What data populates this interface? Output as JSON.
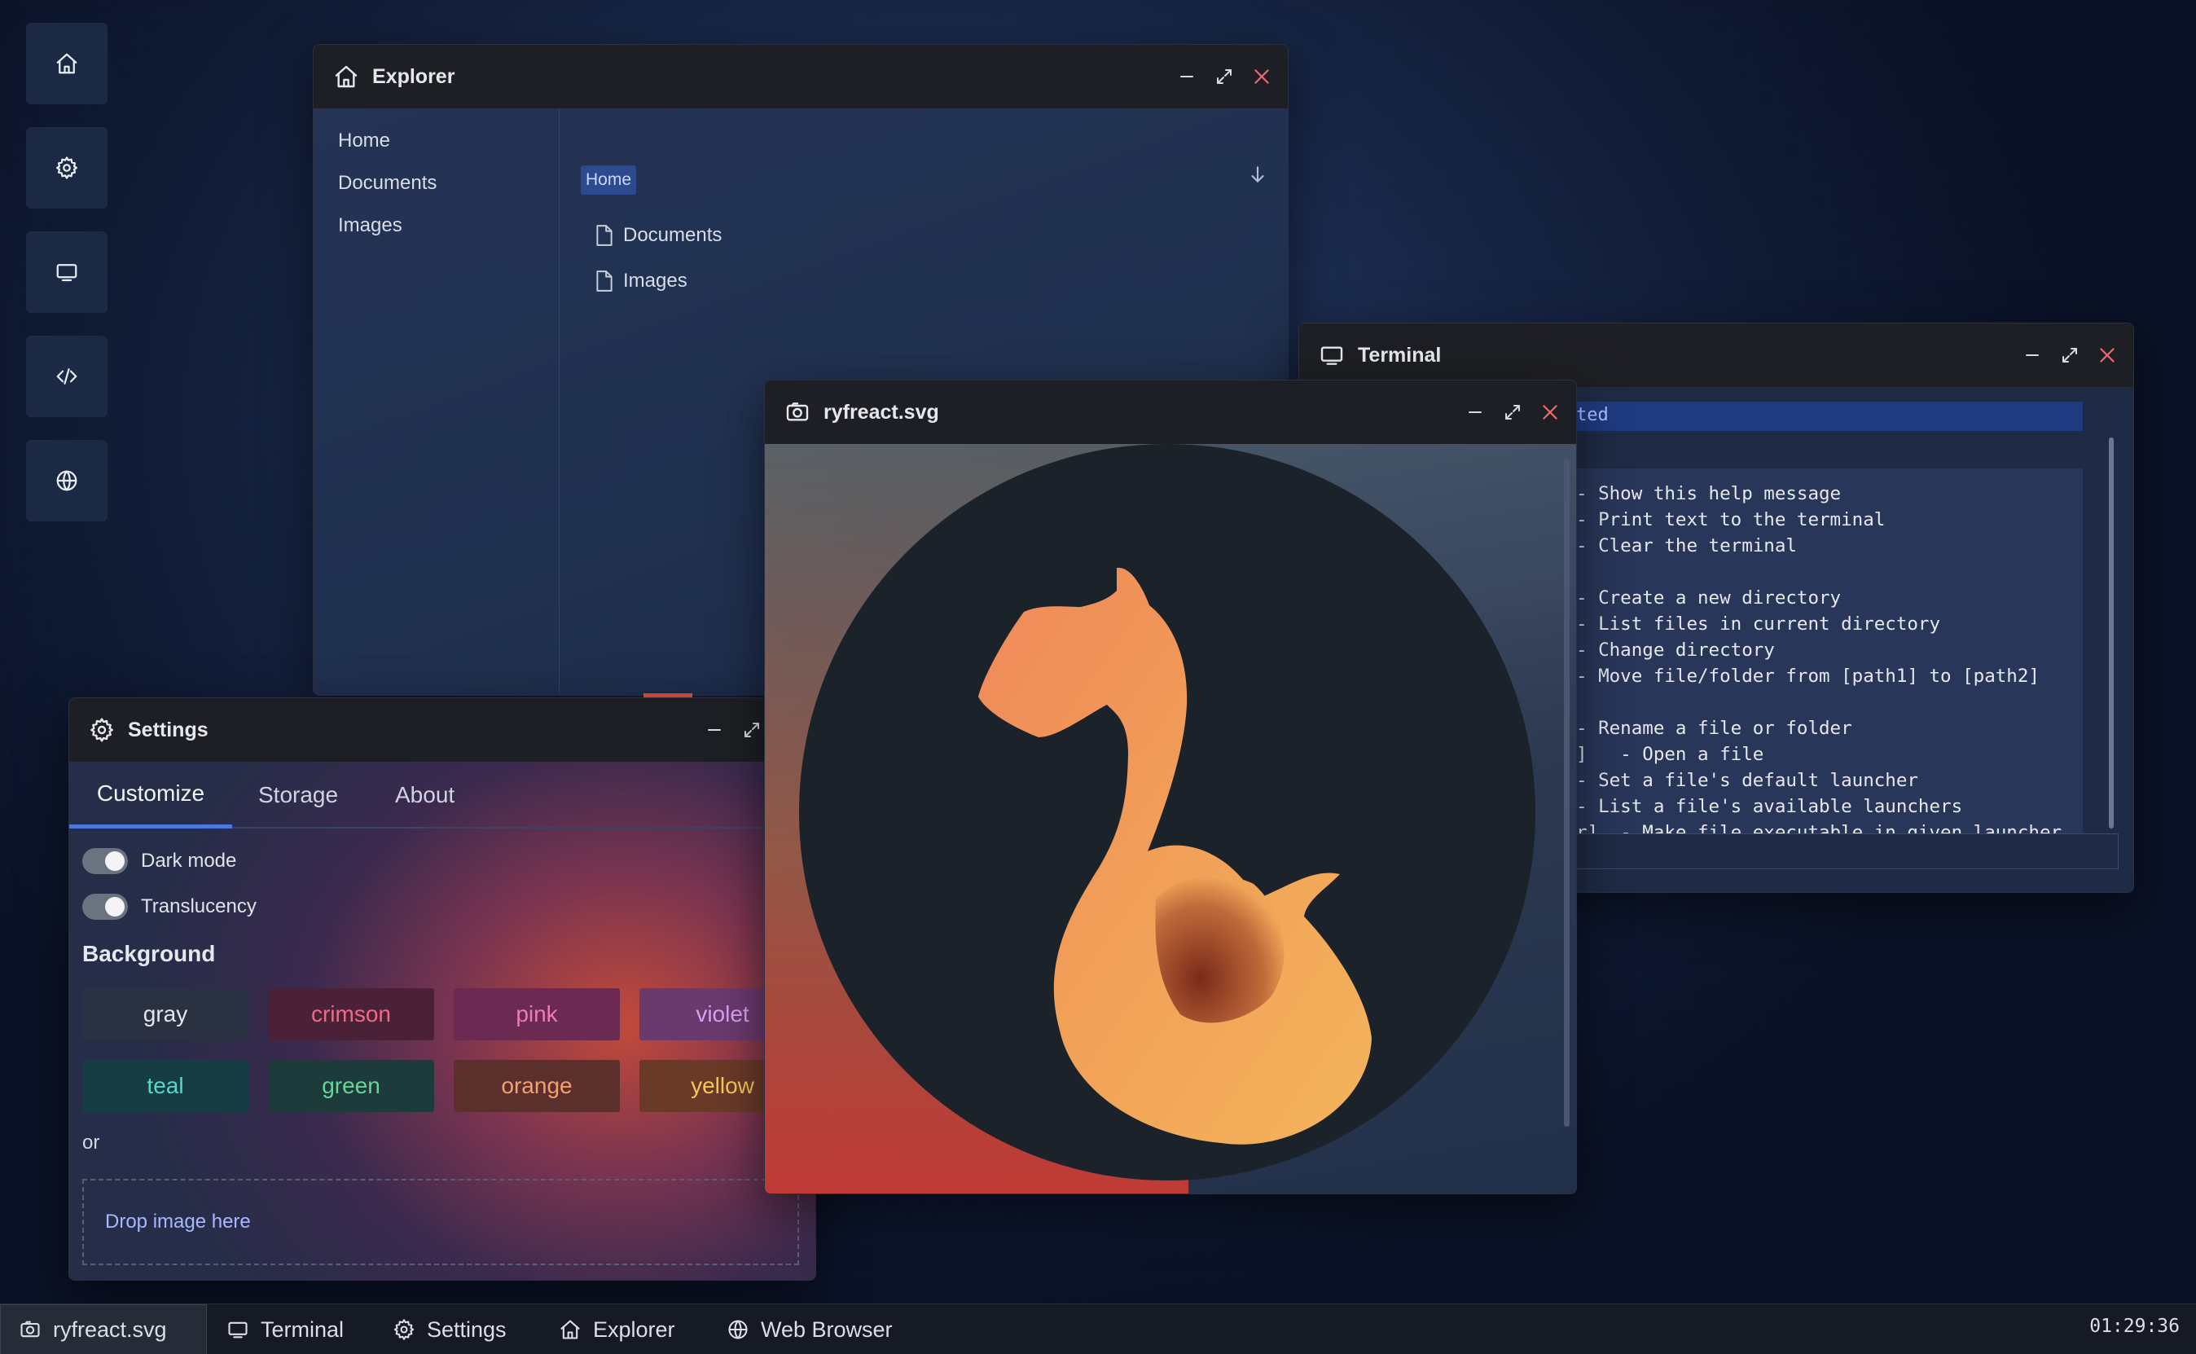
{
  "desktop": {
    "icons": [
      "home-icon",
      "gear-icon",
      "monitor-icon",
      "code-icon",
      "globe-icon"
    ]
  },
  "explorer": {
    "title": "Explorer",
    "sidebar": [
      "Home",
      "Documents",
      "Images"
    ],
    "path": "Home",
    "files": [
      "Documents",
      "Images"
    ]
  },
  "terminal": {
    "title": "Terminal",
    "highlight": "ted",
    "lines": [
      "- Show this help message",
      "- Print text to the terminal",
      "- Clear the terminal",
      "",
      "- Create a new directory",
      "- List files in current directory",
      "- Change directory",
      "- Move file/folder from [path1] to [path2]",
      "",
      "- Rename a file or folder",
      "]   - Open a file",
      "- Set a file's default launcher",
      "- List a file's available launchers",
      "r]  - Make file executable in given launcher"
    ]
  },
  "viewer": {
    "title": "ryfreact.svg"
  },
  "settings": {
    "title": "Settings",
    "tabs": [
      "Customize",
      "Storage",
      "About"
    ],
    "active_tab": "Customize",
    "toggles": [
      {
        "label": "Dark mode",
        "on": true
      },
      {
        "label": "Translucency",
        "on": true
      }
    ],
    "background_heading": "Background",
    "colors": [
      {
        "name": "gray",
        "bg": "#2a3140",
        "fg": "#e4e6ec"
      },
      {
        "name": "crimson",
        "bg": "#4a2136",
        "fg": "#f06a86"
      },
      {
        "name": "pink",
        "bg": "#6a2a52",
        "fg": "#f07ab8"
      },
      {
        "name": "violet",
        "bg": "#6a3a6e",
        "fg": "#d8a0f0"
      },
      {
        "name": "teal",
        "bg": "#173d44",
        "fg": "#5ad6c6"
      },
      {
        "name": "green",
        "bg": "#1c3b3a",
        "fg": "#6ad49a"
      },
      {
        "name": "orange",
        "bg": "#5a2f2c",
        "fg": "#f4a070"
      },
      {
        "name": "yellow",
        "bg": "#6a3a28",
        "fg": "#f6c75a"
      }
    ],
    "or_text": "or",
    "drop_text": "Drop image here"
  },
  "taskbar": {
    "items": [
      {
        "label": "ryfreact.svg",
        "icon": "image-icon",
        "active": true
      },
      {
        "label": "Terminal",
        "icon": "monitor-icon",
        "active": false
      },
      {
        "label": "Settings",
        "icon": "gear-icon",
        "active": false
      },
      {
        "label": "Explorer",
        "icon": "home-icon",
        "active": false
      },
      {
        "label": "Web Browser",
        "icon": "globe-icon",
        "active": false
      }
    ],
    "clock": "01:29:36"
  },
  "colors": {
    "accent": "#4a78e0",
    "close": "#ee6b6b",
    "logo_orange": "#f0a050",
    "logo_circle": "#1b2229"
  }
}
